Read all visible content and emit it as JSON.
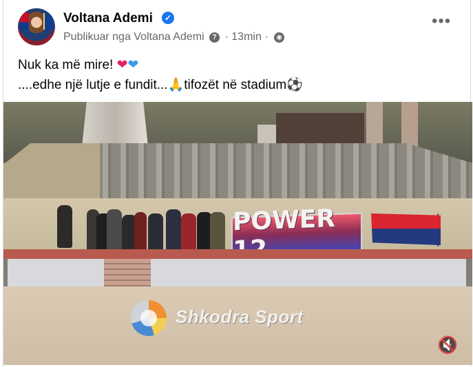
{
  "post": {
    "author_name": "Voltana Ademi",
    "published_by": "Publikuar nga Voltana Ademi",
    "time_ago": "13min",
    "separator": "·",
    "text_line_1_prefix": "Nuk ka më mire!",
    "text_line_2_prefix": "....edhe një lutje e fundit...",
    "text_line_2_mid": "tifozët në stadium"
  },
  "video": {
    "banner_text": "POWER 12",
    "watermark_text": "Shkodra Sport"
  },
  "colors": {
    "accent": "#1877f2",
    "muted_text": "#65676b"
  },
  "icons": {
    "verified": "verified-badge-icon",
    "question": "help-icon",
    "audience": "globe-icon",
    "more": "more-options-icon",
    "mute": "muted-speaker-icon"
  }
}
